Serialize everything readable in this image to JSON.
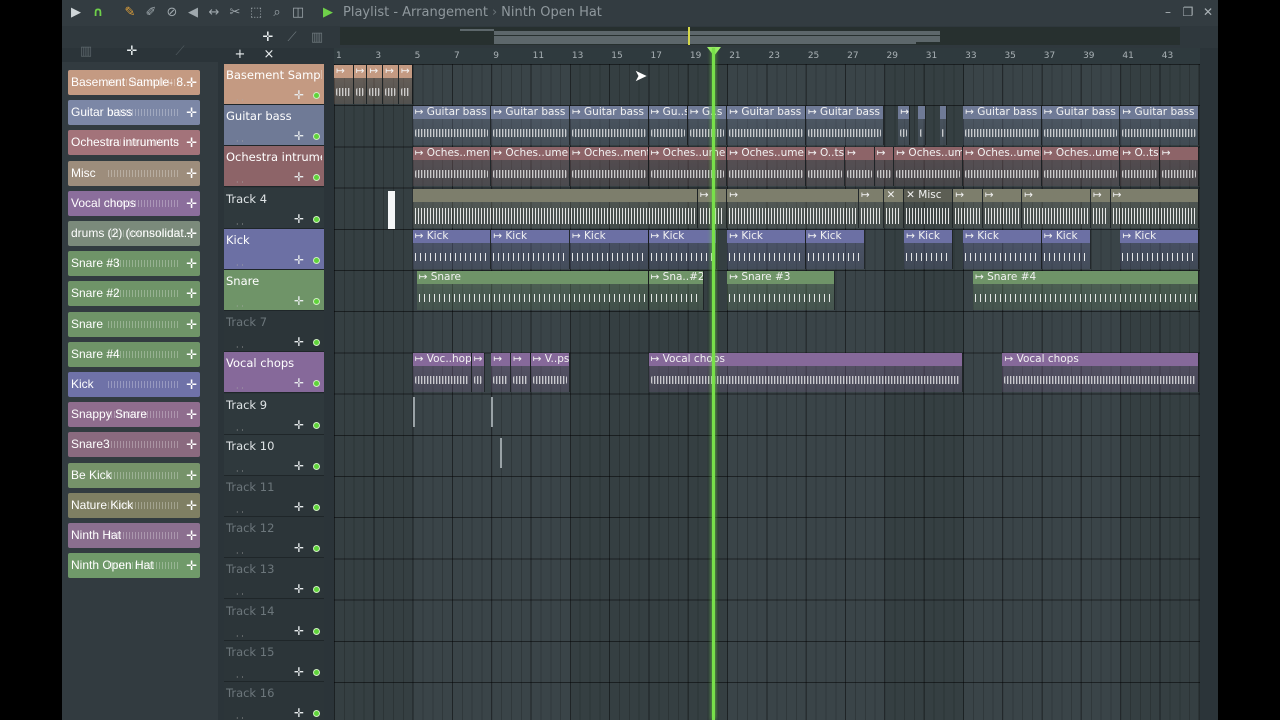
{
  "titlebar": {
    "app_title": "Playlist - Arrangement",
    "separator": "›",
    "selected_pattern": "Ninth Open Hat",
    "window_minimize": "–",
    "window_restore": "❐",
    "window_close": "✕"
  },
  "picker_items": [
    {
      "label": "Basement Sample- 8..",
      "color": "#c49a82"
    },
    {
      "label": "Guitar bass",
      "color": "#7c87a6"
    },
    {
      "label": "Ochestra intruments",
      "color": "#a3737a"
    },
    {
      "label": "Misc",
      "color": "#9d8d7c"
    },
    {
      "label": "Vocal chops",
      "color": "#8b6e9c"
    },
    {
      "label": "drums (2) (consolidat..",
      "color": "#7b8a7b"
    },
    {
      "label": "Snare #3",
      "color": "#6f9468"
    },
    {
      "label": "Snare #2",
      "color": "#6f9468"
    },
    {
      "label": "Snare",
      "color": "#6f9468"
    },
    {
      "label": "Snare #4",
      "color": "#6f9468"
    },
    {
      "label": "Kick",
      "color": "#6f72a8"
    },
    {
      "label": "Snappy Snare",
      "color": "#8f6d8e"
    },
    {
      "label": "Snare3",
      "color": "#8a6a7f"
    },
    {
      "label": "Be Kick",
      "color": "#76936a"
    },
    {
      "label": "Nature Kick",
      "color": "#7f7f63"
    },
    {
      "label": "Ninth Hat",
      "color": "#8b6f8f"
    },
    {
      "label": "Ninth Open Hat",
      "color": "#709a6a"
    }
  ],
  "tracks": [
    {
      "name": "Basement Sample-..",
      "color": "#c49a82",
      "text": "#ffffff"
    },
    {
      "name": "Guitar bass",
      "color": "#6f7a96",
      "text": "#ffffff"
    },
    {
      "name": "Ochestra intruments",
      "color": "#8d6468",
      "text": "#ffffff"
    },
    {
      "name": "Track 4",
      "color": "#2f393d",
      "text": "#dfe4e6"
    },
    {
      "name": "Kick",
      "color": "#6c70a4",
      "text": "#ffffff"
    },
    {
      "name": "Snare",
      "color": "#6f9468",
      "text": "#ffffff"
    },
    {
      "name": "Track 7",
      "color": "#2c3539",
      "text": "#6c767b"
    },
    {
      "name": "Vocal chops",
      "color": "#86699a",
      "text": "#ffffff"
    },
    {
      "name": "Track 9",
      "color": "#2f393d",
      "text": "#dfe4e6"
    },
    {
      "name": "Track 10",
      "color": "#2f393d",
      "text": "#dfe4e6"
    },
    {
      "name": "Track 11",
      "color": "#2c3539",
      "text": "#6c767b"
    },
    {
      "name": "Track 12",
      "color": "#2c3539",
      "text": "#6c767b"
    },
    {
      "name": "Track 13",
      "color": "#2c3539",
      "text": "#6c767b"
    },
    {
      "name": "Track 14",
      "color": "#2c3539",
      "text": "#6c767b"
    },
    {
      "name": "Track 15",
      "color": "#2c3539",
      "text": "#6c767b"
    },
    {
      "name": "Track 16",
      "color": "#2c3539",
      "text": "#6c767b"
    }
  ],
  "ruler_labels": [
    "1",
    "3",
    "5",
    "7",
    "9",
    "11",
    "13",
    "15",
    "17",
    "19",
    "21",
    "23",
    "25",
    "27",
    "29",
    "31",
    "33",
    "35",
    "37",
    "39",
    "41",
    "43"
  ],
  "clip_symbol": "↦",
  "clips": [
    {
      "track": 0,
      "start": 1,
      "end": 2,
      "label": "↦",
      "color": "#c49a82",
      "wave": "aud"
    },
    {
      "track": 0,
      "start": 2,
      "end": 2.7,
      "label": "↦",
      "color": "#c49a82",
      "wave": "aud"
    },
    {
      "track": 0,
      "start": 2.7,
      "end": 3.5,
      "label": "↦",
      "color": "#c49a82",
      "wave": "aud"
    },
    {
      "track": 0,
      "start": 3.5,
      "end": 4.3,
      "label": "↦",
      "color": "#c49a82",
      "wave": "aud"
    },
    {
      "track": 0,
      "start": 4.3,
      "end": 5,
      "label": "↦",
      "color": "#c49a82",
      "wave": "aud"
    },
    {
      "track": 1,
      "start": 5,
      "end": 9,
      "label": "↦ Guitar bass",
      "color": "#6f7a96",
      "wave": "aud"
    },
    {
      "track": 1,
      "start": 9,
      "end": 13,
      "label": "↦ Guitar bass",
      "color": "#6f7a96",
      "wave": "aud"
    },
    {
      "track": 1,
      "start": 13,
      "end": 17,
      "label": "↦ Guitar bass",
      "color": "#6f7a96",
      "wave": "aud"
    },
    {
      "track": 1,
      "start": 17,
      "end": 19,
      "label": "↦ Gu..s",
      "color": "#6f7a96",
      "wave": "aud"
    },
    {
      "track": 1,
      "start": 19,
      "end": 21,
      "label": "↦ G..s",
      "color": "#6f7a96",
      "wave": "aud"
    },
    {
      "track": 1,
      "start": 21,
      "end": 25,
      "label": "↦ Guitar bass",
      "color": "#6f7a96",
      "wave": "aud"
    },
    {
      "track": 1,
      "start": 25,
      "end": 29,
      "label": "↦ Guitar bass",
      "color": "#6f7a96",
      "wave": "aud"
    },
    {
      "track": 1,
      "start": 29.7,
      "end": 30.3,
      "label": "↦",
      "color": "#6f7a96",
      "wave": "aud"
    },
    {
      "track": 1,
      "start": 30.7,
      "end": 31.1,
      "label": "",
      "color": "#6f7a96",
      "wave": "aud"
    },
    {
      "track": 1,
      "start": 31.8,
      "end": 32.2,
      "label": "",
      "color": "#6f7a96",
      "wave": "aud"
    },
    {
      "track": 1,
      "start": 33,
      "end": 37,
      "label": "↦ Guitar bass",
      "color": "#6f7a96",
      "wave": "aud"
    },
    {
      "track": 1,
      "start": 37,
      "end": 41,
      "label": "↦ Guitar bass",
      "color": "#6f7a96",
      "wave": "aud"
    },
    {
      "track": 1,
      "start": 41,
      "end": 45,
      "label": "↦ Guitar bass",
      "color": "#6f7a96",
      "wave": "aud"
    },
    {
      "track": 2,
      "start": 5,
      "end": 9,
      "label": "↦ Oches..ments",
      "color": "#8d6468",
      "wave": "aud"
    },
    {
      "track": 2,
      "start": 9,
      "end": 13,
      "label": "↦ Oches..uments",
      "color": "#8d6468",
      "wave": "aud"
    },
    {
      "track": 2,
      "start": 13,
      "end": 17,
      "label": "↦ Oches..ments",
      "color": "#8d6468",
      "wave": "aud"
    },
    {
      "track": 2,
      "start": 17,
      "end": 21,
      "label": "↦ Oches..uments",
      "color": "#8d6468",
      "wave": "aud"
    },
    {
      "track": 2,
      "start": 21,
      "end": 25,
      "label": "↦ Oches..uments",
      "color": "#8d6468",
      "wave": "aud"
    },
    {
      "track": 2,
      "start": 25,
      "end": 27,
      "label": "↦ O..ts",
      "color": "#8d6468",
      "wave": "aud"
    },
    {
      "track": 2,
      "start": 27,
      "end": 28.5,
      "label": "↦",
      "color": "#8d6468",
      "wave": "aud"
    },
    {
      "track": 2,
      "start": 28.5,
      "end": 29.5,
      "label": "↦",
      "color": "#8d6468",
      "wave": "aud"
    },
    {
      "track": 2,
      "start": 29.5,
      "end": 33,
      "label": "↦ Oches..uments",
      "color": "#8d6468",
      "wave": "aud"
    },
    {
      "track": 2,
      "start": 33,
      "end": 37,
      "label": "↦ Oches..uments",
      "color": "#8d6468",
      "wave": "aud"
    },
    {
      "track": 2,
      "start": 37,
      "end": 41,
      "label": "↦ Oches..uments",
      "color": "#8d6468",
      "wave": "aud"
    },
    {
      "track": 2,
      "start": 41,
      "end": 43,
      "label": "↦ O..ts",
      "color": "#8d6468",
      "wave": "aud"
    },
    {
      "track": 2,
      "start": 43,
      "end": 45,
      "label": "↦",
      "color": "#8d6468",
      "wave": "aud"
    },
    {
      "track": 3,
      "start": 5,
      "end": 19.5,
      "label": "",
      "color": "#7d7e6c",
      "wave": "dense"
    },
    {
      "track": 3,
      "start": 19.5,
      "end": 21,
      "label": "↦",
      "color": "#7d7e6c",
      "wave": "dense"
    },
    {
      "track": 3,
      "start": 21,
      "end": 27.7,
      "label": "↦",
      "color": "#7d7e6c",
      "wave": "dense"
    },
    {
      "track": 3,
      "start": 27.7,
      "end": 29,
      "label": "↦",
      "color": "#7d7e6c",
      "wave": "dense"
    },
    {
      "track": 3,
      "start": 29,
      "end": 30,
      "label": "✕",
      "color": "#7d7e6c",
      "wave": "dense"
    },
    {
      "track": 3,
      "start": 30,
      "end": 32.5,
      "label": "✕ Misc",
      "color": "#5c5e54",
      "wave": "dense"
    },
    {
      "track": 3,
      "start": 32.5,
      "end": 34,
      "label": "↦",
      "color": "#7d7e6c",
      "wave": "dense"
    },
    {
      "track": 3,
      "start": 34,
      "end": 36,
      "label": "↦",
      "color": "#7d7e6c",
      "wave": "dense"
    },
    {
      "track": 3,
      "start": 36,
      "end": 39.5,
      "label": "↦",
      "color": "#7d7e6c",
      "wave": "dense"
    },
    {
      "track": 3,
      "start": 39.5,
      "end": 40.5,
      "label": "↦",
      "color": "#7d7e6c",
      "wave": "dense"
    },
    {
      "track": 3,
      "start": 40.5,
      "end": 45,
      "label": "↦",
      "color": "#7d7e6c",
      "wave": "dense"
    },
    {
      "track": 4,
      "start": 5,
      "end": 9,
      "label": "↦ Kick",
      "color": "#6c70a4",
      "wave": "hit"
    },
    {
      "track": 4,
      "start": 9,
      "end": 13,
      "label": "↦ Kick",
      "color": "#6c70a4",
      "wave": "hit"
    },
    {
      "track": 4,
      "start": 13,
      "end": 17,
      "label": "↦ Kick",
      "color": "#6c70a4",
      "wave": "hit"
    },
    {
      "track": 4,
      "start": 17,
      "end": 20.5,
      "label": "↦ Kick",
      "color": "#6c70a4",
      "wave": "hit"
    },
    {
      "track": 4,
      "start": 21,
      "end": 25,
      "label": "↦ Kick",
      "color": "#6c70a4",
      "wave": "hit"
    },
    {
      "track": 4,
      "start": 25,
      "end": 28,
      "label": "↦ Kick",
      "color": "#6c70a4",
      "wave": "hit"
    },
    {
      "track": 4,
      "start": 30,
      "end": 32.5,
      "label": "↦ Kick",
      "color": "#6c70a4",
      "wave": "hit"
    },
    {
      "track": 4,
      "start": 33,
      "end": 37,
      "label": "↦ Kick",
      "color": "#6c70a4",
      "wave": "hit"
    },
    {
      "track": 4,
      "start": 37,
      "end": 39.5,
      "label": "↦ Kick",
      "color": "#6c70a4",
      "wave": "hit"
    },
    {
      "track": 4,
      "start": 41,
      "end": 45,
      "label": "↦ Kick",
      "color": "#6c70a4",
      "wave": "hit"
    },
    {
      "track": 5,
      "start": 5.2,
      "end": 17,
      "label": "↦ Snare",
      "color": "#6f9468",
      "wave": "hit"
    },
    {
      "track": 5,
      "start": 17,
      "end": 19.8,
      "label": "↦ Sna..#2",
      "color": "#6f9468",
      "wave": "hit"
    },
    {
      "track": 5,
      "start": 21,
      "end": 26.5,
      "label": "↦ Snare #3",
      "color": "#6f9468",
      "wave": "hit"
    },
    {
      "track": 5,
      "start": 33.5,
      "end": 45,
      "label": "↦ Snare #4",
      "color": "#6f9468",
      "wave": "hit"
    },
    {
      "track": 7,
      "start": 5,
      "end": 8,
      "label": "↦ Voc..hops",
      "color": "#86699a",
      "wave": "aud"
    },
    {
      "track": 7,
      "start": 8,
      "end": 8.7,
      "label": "↦",
      "color": "#86699a",
      "wave": "aud"
    },
    {
      "track": 7,
      "start": 9,
      "end": 10,
      "label": "↦",
      "color": "#86699a",
      "wave": "aud"
    },
    {
      "track": 7,
      "start": 10,
      "end": 11,
      "label": "↦",
      "color": "#86699a",
      "wave": "aud"
    },
    {
      "track": 7,
      "start": 11,
      "end": 13,
      "label": "↦ V..ps",
      "color": "#86699a",
      "wave": "aud"
    },
    {
      "track": 7,
      "start": 17,
      "end": 33,
      "label": "↦ Vocal chops",
      "color": "#86699a",
      "wave": "aud"
    },
    {
      "track": 7,
      "start": 35,
      "end": 45,
      "label": "↦ Vocal chops",
      "color": "#86699a",
      "wave": "aud"
    }
  ],
  "playhead_bar": 23.4,
  "icons": {
    "play": "▶",
    "magnet": "∩",
    "pencil": "✎",
    "brush": "✐",
    "delete": "⊘",
    "mute": "◀",
    "slip": "↔",
    "slice": "✂",
    "select": "⬚",
    "zoom": "⌕",
    "playback": "◫",
    "add": "+",
    "remove": "×",
    "drag": "✛",
    "track_drag": "✛",
    "scroll_up": "▴",
    "scroll_down": "▾"
  }
}
